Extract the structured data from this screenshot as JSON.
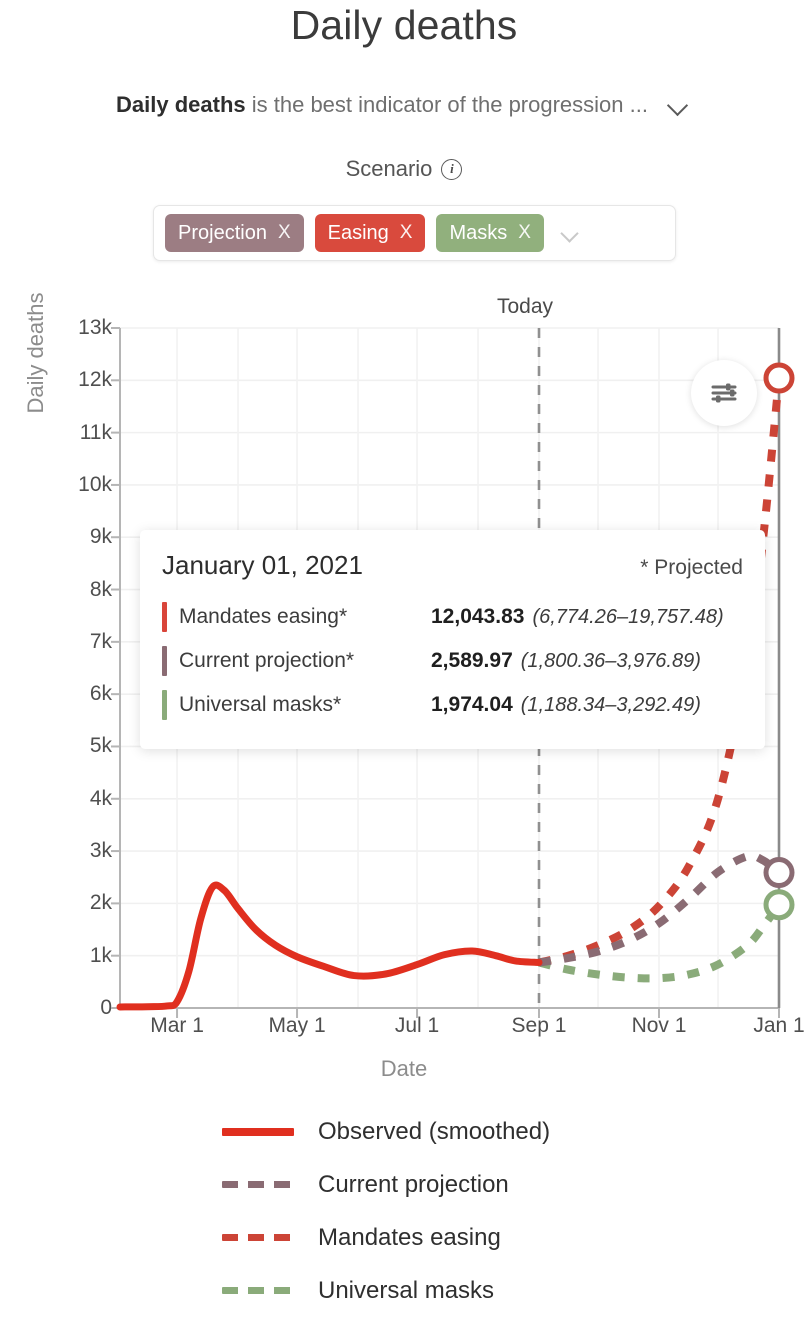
{
  "header": {
    "title": "Daily deaths",
    "subtitle_bold": "Daily deaths",
    "subtitle_rest": " is the best indicator of the progression ...",
    "expand_icon": "chevron-down-icon"
  },
  "scenario": {
    "label": "Scenario",
    "info_icon": "info-icon",
    "chips": [
      {
        "label": "Projection",
        "remove": "X",
        "color": "#9c7d83"
      },
      {
        "label": "Easing",
        "remove": "X",
        "color": "#d94a3d"
      },
      {
        "label": "Masks",
        "remove": "X",
        "color": "#91b07d"
      }
    ],
    "dropdown_icon": "chevron-down-icon"
  },
  "chart_annotations": {
    "today_label": "Today",
    "settings_icon": "sliders-icon"
  },
  "tooltip": {
    "date": "January 01, 2021",
    "projected_note": "* Projected",
    "rows": [
      {
        "name": "Mandates easing*",
        "value": "12,043.83",
        "ci": "(6,774.26–19,757.48)",
        "color": "#d9453a"
      },
      {
        "name": "Current projection*",
        "value": "2,589.97",
        "ci": "(1,800.36–3,976.89)",
        "color": "#8a6b73"
      },
      {
        "name": "Universal masks*",
        "value": "1,974.04",
        "ci": "(1,188.34–3,292.49)",
        "color": "#8aab7a"
      }
    ]
  },
  "legend": {
    "items": [
      {
        "label": "Observed (smoothed)",
        "color": "#e02f1f",
        "style": "solid"
      },
      {
        "label": "Current projection",
        "color": "#8a6b73",
        "style": "dashed"
      },
      {
        "label": "Mandates easing",
        "color": "#cc4436",
        "style": "dashed"
      },
      {
        "label": "Universal masks",
        "color": "#8aab7a",
        "style": "dashed"
      }
    ]
  },
  "chart_data": {
    "type": "line",
    "title": "Daily deaths",
    "xlabel": "Date",
    "ylabel": "Daily deaths",
    "ylim": [
      0,
      13000
    ],
    "yticks": [
      "0",
      "1k",
      "2k",
      "3k",
      "4k",
      "5k",
      "6k",
      "7k",
      "8k",
      "9k",
      "10k",
      "11k",
      "12k",
      "13k"
    ],
    "ytick_values": [
      0,
      1000,
      2000,
      3000,
      4000,
      5000,
      6000,
      7000,
      8000,
      9000,
      10000,
      11000,
      12000,
      13000
    ],
    "xticks": [
      "Mar 1",
      "May 1",
      "Jul 1",
      "Sep 1",
      "Nov 1",
      "Jan 1"
    ],
    "xtick_values": [
      60,
      121,
      182,
      244,
      305,
      366
    ],
    "xlim": [
      31,
      366
    ],
    "grid": true,
    "legend_position": "bottom",
    "today_marker": {
      "label": "Today",
      "x_value": 244,
      "style": "dashed-vertical"
    },
    "end_marker_line": {
      "x_value": 366,
      "style": "solid-vertical"
    },
    "series": [
      {
        "name": "Observed (smoothed)",
        "color": "#e02f1f",
        "style": "solid",
        "x": [
          31,
          45,
          55,
          60,
          66,
          72,
          78,
          84,
          91,
          100,
          110,
          121,
          135,
          150,
          166,
          182,
          196,
          210,
          222,
          232,
          244
        ],
        "values": [
          20,
          25,
          40,
          120,
          700,
          1700,
          2310,
          2250,
          1900,
          1500,
          1200,
          980,
          790,
          620,
          650,
          830,
          1020,
          1090,
          1000,
          900,
          870
        ]
      },
      {
        "name": "Current projection",
        "color": "#8a6b73",
        "style": "dashed",
        "x": [
          244,
          258,
          274,
          290,
          305,
          320,
          335,
          350,
          358,
          366
        ],
        "values": [
          870,
          950,
          1080,
          1300,
          1620,
          2080,
          2600,
          2900,
          2820,
          2589.97
        ]
      },
      {
        "name": "Mandates easing",
        "color": "#cc4436",
        "style": "dashed",
        "x": [
          244,
          258,
          274,
          290,
          305,
          320,
          335,
          350,
          358,
          366
        ],
        "values": [
          870,
          990,
          1200,
          1500,
          1950,
          2700,
          4000,
          6600,
          9000,
          12043.83
        ]
      },
      {
        "name": "Universal masks",
        "color": "#8aab7a",
        "style": "dashed",
        "x": [
          244,
          258,
          274,
          290,
          305,
          320,
          335,
          350,
          358,
          366
        ],
        "values": [
          870,
          740,
          640,
          580,
          570,
          640,
          830,
          1200,
          1560,
          1974.04
        ]
      }
    ],
    "end_points": [
      {
        "series": "Mandates easing",
        "value": 12043.83,
        "color": "#cc4436",
        "marker": "open-circle"
      },
      {
        "series": "Current projection",
        "value": 2589.97,
        "color": "#8a6b73",
        "marker": "open-circle"
      },
      {
        "series": "Universal masks",
        "value": 1974.04,
        "color": "#8aab7a",
        "marker": "open-circle"
      }
    ]
  }
}
